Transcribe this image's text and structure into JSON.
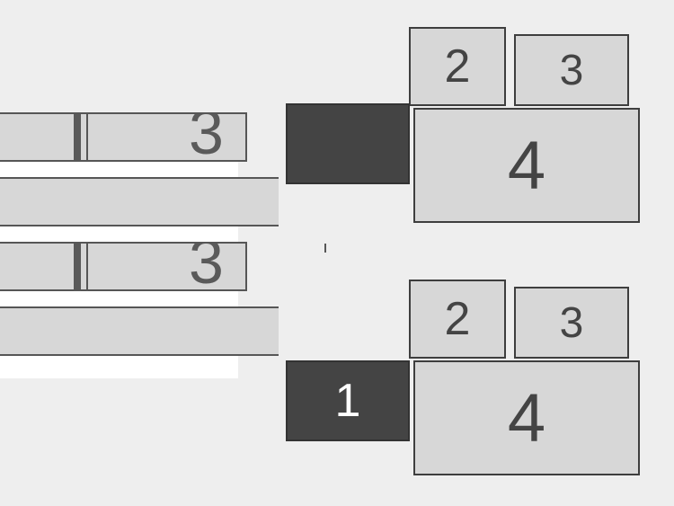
{
  "top_section": {
    "left_zoom": {
      "visible_label": "3"
    },
    "right_layout": {
      "monitors": {
        "monitor_1": {
          "label": "",
          "primary": true
        },
        "monitor_2": {
          "label": "2",
          "primary": false
        },
        "monitor_3": {
          "label": "3",
          "primary": false
        },
        "monitor_4": {
          "label": "4",
          "primary": false
        }
      }
    }
  },
  "bottom_section": {
    "left_zoom": {
      "visible_label": "3"
    },
    "right_layout": {
      "monitors": {
        "monitor_1": {
          "label": "1",
          "primary": true
        },
        "monitor_2": {
          "label": "2",
          "primary": false
        },
        "monitor_3": {
          "label": "3",
          "primary": false
        },
        "monitor_4": {
          "label": "4",
          "primary": false
        }
      }
    }
  }
}
